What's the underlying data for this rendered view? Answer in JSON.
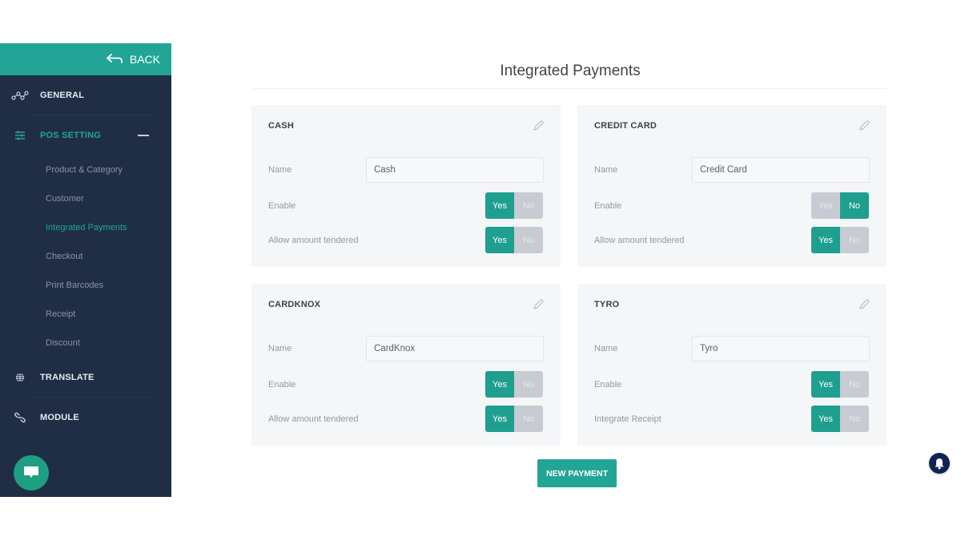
{
  "sidebar": {
    "back_label": "BACK",
    "sections": [
      {
        "label": "GENERAL",
        "icon": "nodes-icon",
        "active": false
      },
      {
        "label": "POS SETTING",
        "icon": "sliders-icon",
        "active": true,
        "expanded": true
      },
      {
        "label": "TRANSLATE",
        "icon": "globe-icon",
        "active": false
      },
      {
        "label": "MODULE",
        "icon": "link-icon",
        "active": false
      }
    ],
    "pos_subitems": [
      {
        "label": "Product & Category",
        "active": false
      },
      {
        "label": "Customer",
        "active": false
      },
      {
        "label": "Integrated Payments",
        "active": true
      },
      {
        "label": "Checkout",
        "active": false
      },
      {
        "label": "Print Barcodes",
        "active": false
      },
      {
        "label": "Receipt",
        "active": false
      },
      {
        "label": "Discount",
        "active": false
      }
    ]
  },
  "main": {
    "title": "Integrated Payments",
    "name_label": "Name",
    "yes_label": "Yes",
    "no_label": "No",
    "cards": [
      {
        "title": "CASH",
        "name_value": "Cash",
        "toggles": [
          {
            "label": "Enable",
            "value": "Yes"
          },
          {
            "label": "Allow amount tendered",
            "value": "Yes"
          }
        ]
      },
      {
        "title": "CREDIT CARD",
        "name_value": "Credit Card",
        "toggles": [
          {
            "label": "Enable",
            "value": "No"
          },
          {
            "label": "Allow amount tendered",
            "value": "Yes"
          }
        ]
      },
      {
        "title": "CARDKNOX",
        "name_value": "CardKnox",
        "toggles": [
          {
            "label": "Enable",
            "value": "Yes"
          },
          {
            "label": "Allow amount tendered",
            "value": "Yes"
          }
        ]
      },
      {
        "title": "TYRO",
        "name_value": "Tyro",
        "toggles": [
          {
            "label": "Enable",
            "value": "Yes"
          },
          {
            "label": "Integrate Receipt",
            "value": "Yes"
          }
        ]
      }
    ],
    "new_payment_label": "NEW PAYMENT"
  },
  "colors": {
    "accent": "#22a596",
    "sidebar_bg": "#1f2e45",
    "toggle_off": "#c8ccd2",
    "bell_bg": "#0f2550"
  }
}
